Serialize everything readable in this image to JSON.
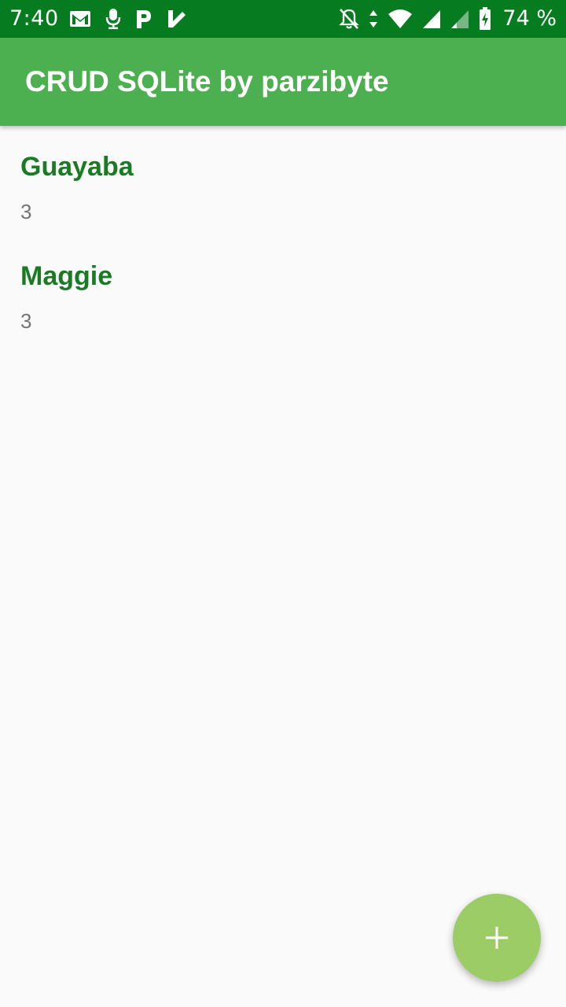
{
  "status_bar": {
    "time": "7:40",
    "left_icons": [
      "gmail-icon",
      "microphone-icon",
      "parking-icon",
      "checkmark-app-icon"
    ],
    "right_icons": [
      "notifications-off-icon",
      "data-transfer-icon",
      "wifi-icon",
      "signal-icon",
      "signal-weak-icon",
      "battery-charging-icon"
    ],
    "battery": "74 %",
    "battery_level": 74
  },
  "app_bar": {
    "title": "CRUD SQLite by parzibyte"
  },
  "list": {
    "items": [
      {
        "name": "Guayaba",
        "value": "3"
      },
      {
        "name": "Maggie",
        "value": "3"
      }
    ]
  },
  "fab": {
    "icon": "plus-icon"
  },
  "colors": {
    "status_bar": "#067b1f",
    "app_bar": "#4caf50",
    "item_name": "#1b7a24",
    "item_value": "#757575",
    "fab": "#9ccc65",
    "background": "#fafafa"
  }
}
